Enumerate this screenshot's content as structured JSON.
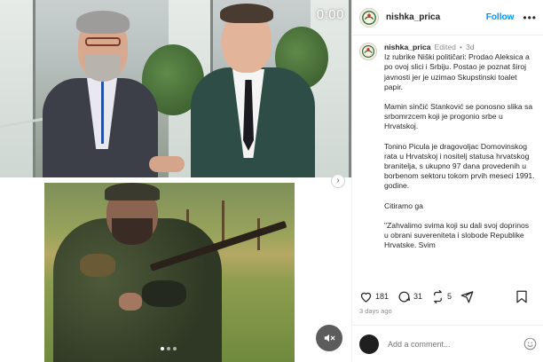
{
  "media": {
    "timer": "0:00",
    "carousel_total": 3,
    "carousel_active": 0
  },
  "header": {
    "username": "nishka_prica",
    "follow_label": "Follow",
    "more_label": "•••"
  },
  "caption": {
    "username": "nishka_prica",
    "edited": "Edited",
    "separator": "•",
    "age": "3d",
    "paragraphs": [
      "Iz rubrike Niški političari: Prodao Aleksica a po ovoj slici i Srbiju. Postao je poznat široj javnosti  jer je uzimao Skupstinski toalet papir.",
      "Mamin sinčić  Stanković se ponosno slika sa srbomrzcem koji je progonio srbe u Hrvatskoj.",
      "Tonino Picula je dragovoljac Domovinskog rata u Hrvatskoj i nositelj statusa hrvatskog branitelja, s ukupno 97 dana provedenih u borbenom sektoru tokom prvih meseci 1991. godine.",
      "Citiramo ga",
      "\"Zahvalimo svima koji su dali svoj doprinos u obrani suvereniteta i slobode Republike Hrvatske. Svim"
    ]
  },
  "actions": {
    "likes": "181",
    "comments": "31",
    "reposts": "5"
  },
  "post_time": "3 days ago",
  "comment": {
    "placeholder": "Add a comment..."
  },
  "colors": {
    "accent": "#0095f6",
    "muted": "#8e8e8e",
    "text": "#262626"
  },
  "icons": [
    "heart-icon",
    "comment-icon",
    "repost-icon",
    "share-icon",
    "bookmark-icon",
    "mute-icon",
    "emoji-icon",
    "chevron-right-icon"
  ]
}
